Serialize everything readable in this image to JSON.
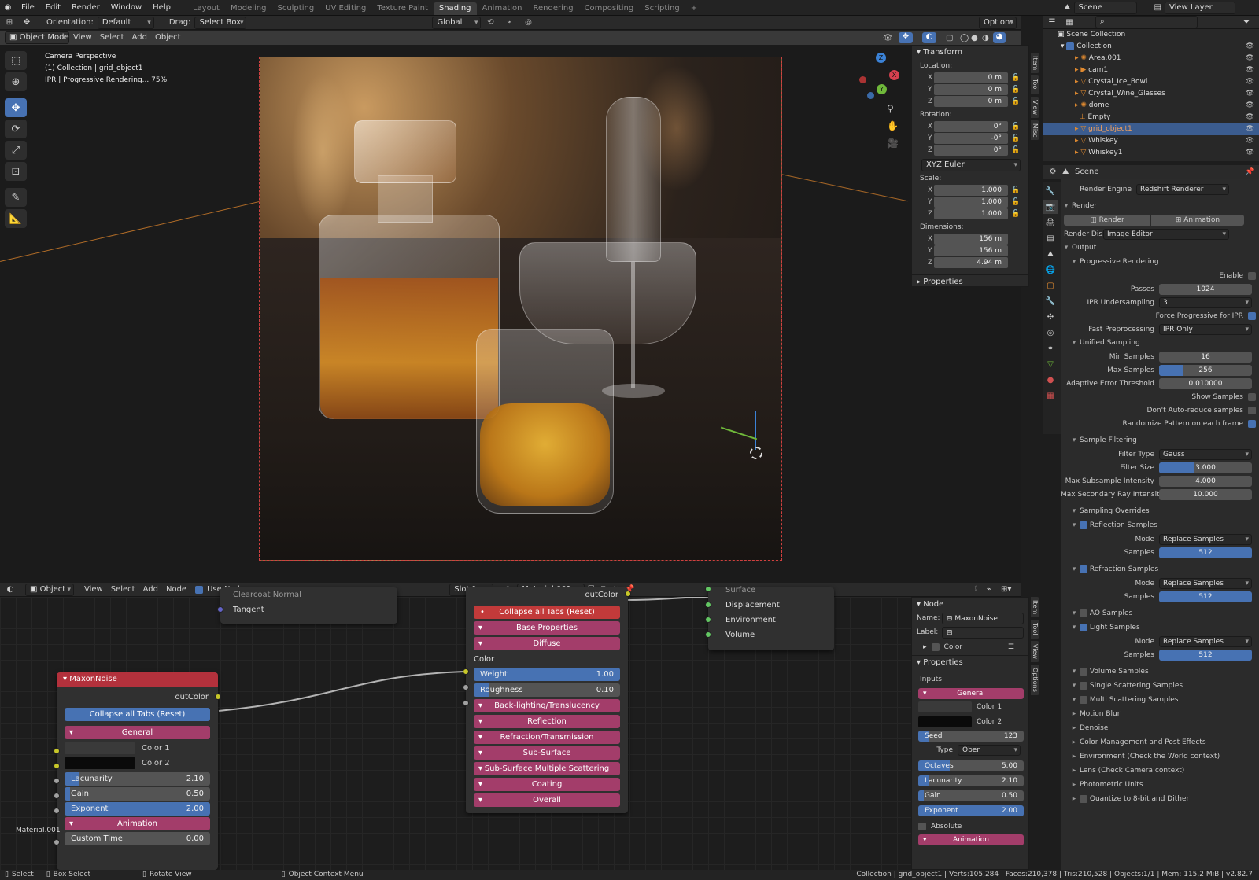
{
  "topbar": {
    "menus": [
      "File",
      "Edit",
      "Render",
      "Window",
      "Help"
    ],
    "workspaces": [
      "Layout",
      "Modeling",
      "Sculpting",
      "UV Editing",
      "Texture Paint",
      "Shading",
      "Animation",
      "Rendering",
      "Compositing",
      "Scripting"
    ],
    "active_workspace": "Shading",
    "add_tab": "+",
    "scene": "Scene",
    "view_layer": "View Layer"
  },
  "viewport_header": {
    "orientation_label": "Orientation:",
    "orientation_value": "Default",
    "drag_label": "Drag:",
    "drag_value": "Select Box",
    "transform_space": "Global",
    "options": "Options",
    "mode": "Object Mode",
    "menus": [
      "View",
      "Select",
      "Add",
      "Object"
    ]
  },
  "viewport_overlay": {
    "line1": "Camera Perspective",
    "line2": "(1) Collection | grid_object1",
    "line3": "IPR | Progressive Rendering... 75%"
  },
  "gizmo": {
    "x": "X",
    "y": "Y",
    "z": "Z"
  },
  "transform_panel": {
    "title": "Transform",
    "location_label": "Location:",
    "location": [
      {
        "axis": "X",
        "value": "0 m"
      },
      {
        "axis": "Y",
        "value": "0 m"
      },
      {
        "axis": "Z",
        "value": "0 m"
      }
    ],
    "rotation_label": "Rotation:",
    "rotation": [
      {
        "axis": "X",
        "value": "0°"
      },
      {
        "axis": "Y",
        "value": "-0°"
      },
      {
        "axis": "Z",
        "value": "0°"
      }
    ],
    "rotation_mode": "XYZ Euler",
    "scale_label": "Scale:",
    "scale": [
      {
        "axis": "X",
        "value": "1.000"
      },
      {
        "axis": "Y",
        "value": "1.000"
      },
      {
        "axis": "Z",
        "value": "1.000"
      }
    ],
    "dimensions_label": "Dimensions:",
    "dimensions": [
      {
        "axis": "X",
        "value": "156 m"
      },
      {
        "axis": "Y",
        "value": "156 m"
      },
      {
        "axis": "Z",
        "value": "4.94 m"
      }
    ],
    "properties": "Properties"
  },
  "side_tabs": [
    "Item",
    "Tool",
    "View",
    "Misc"
  ],
  "outliner": {
    "root": "Scene Collection",
    "collection": "Collection",
    "items": [
      "Area.001",
      "cam1",
      "Crystal_Ice_Bowl",
      "Crystal_Wine_Glasses",
      "dome",
      "Empty",
      "grid_object1",
      "Whiskey",
      "Whiskey1"
    ],
    "selected": "grid_object1"
  },
  "properties": {
    "scene_label": "Scene",
    "render_engine_label": "Render Engine",
    "render_engine": "Redshift Renderer",
    "render_section": "Render",
    "render_btn": "Render",
    "animation_btn": "Animation",
    "render_display_label": "Render Dis...",
    "render_display": "Image Editor",
    "output": "Output",
    "progressive": "Progressive Rendering",
    "enable": "Enable",
    "passes_label": "Passes",
    "passes": "1024",
    "ipr_under_label": "IPR Undersampling",
    "ipr_under": "3",
    "force_prog": "Force Progressive for IPR",
    "fast_pre_label": "Fast Preprocessing",
    "fast_pre": "IPR Only",
    "unified": "Unified Sampling",
    "min_samples_label": "Min Samples",
    "min_samples": "16",
    "max_samples_label": "Max Samples",
    "max_samples": "256",
    "max_samples_fraction": 0.25,
    "aet_label": "Adaptive Error Threshold",
    "aet": "0.010000",
    "show_samples": "Show Samples",
    "dont_auto": "Don't Auto-reduce samples",
    "randomize": "Randomize Pattern on each frame",
    "sample_filtering": "Sample Filtering",
    "filter_type_label": "Filter Type",
    "filter_type": "Gauss",
    "filter_size_label": "Filter Size",
    "filter_size": "3.000",
    "filter_size_fraction": 0.38,
    "max_sub_label": "Max Subsample Intensity",
    "max_sub": "4.000",
    "max_sec_label": "Max Secondary Ray Intensity",
    "max_sec": "10.000",
    "sampling_overrides": "Sampling Overrides",
    "reflection_samples": "Reflection Samples",
    "mode_label": "Mode",
    "replace_samples": "Replace Samples",
    "samples_label": "Samples",
    "samples_value": "512",
    "refraction_samples": "Refraction Samples",
    "ao_samples": "AO Samples",
    "light_samples": "Light Samples",
    "volume_samples": "Volume Samples",
    "single_scatter": "Single Scattering Samples",
    "multi_scatter": "Multi Scattering Samples",
    "motion_blur": "Motion Blur",
    "denoise": "Denoise",
    "color_mgmt": "Color Management and Post Effects",
    "environment": "Environment (Check the World context)",
    "lens": "Lens (Check Camera context)",
    "photometric": "Photometric Units",
    "quantize": "Quantize to 8-bit and Dither"
  },
  "node_header": {
    "editor_type": "Object",
    "menus": [
      "View",
      "Select",
      "Add",
      "Node"
    ],
    "use_nodes": "Use Nodes",
    "slot": "Slot 1",
    "material": "Material.001"
  },
  "node_sidebar": {
    "title": "Node",
    "name_label": "Name:",
    "name": "MaxonNoise",
    "label_label": "Label:",
    "color": "Color",
    "properties": "Properties",
    "inputs": "Inputs:",
    "general": "General",
    "color1": "Color 1",
    "color2": "Color 2",
    "seed_label": "Seed",
    "seed": "123",
    "type_label": "Type",
    "type": "Ober",
    "octaves_label": "Octaves",
    "octaves": "5.00",
    "lacunarity_label": "Lacunarity",
    "lacunarity": "2.10",
    "gain_label": "Gain",
    "gain": "0.50",
    "exponent_label": "Exponent",
    "exponent": "2.00",
    "absolute": "Absolute",
    "animation": "Animation",
    "side_tabs": [
      "Item",
      "Tool",
      "View",
      "Options"
    ]
  },
  "nodes": {
    "top_left_partial": "Clearcoat Normal",
    "tangent": "Tangent",
    "maxon_title": "MaxonNoise",
    "out_color": "outColor",
    "collapse": "Collapse all Tabs (Reset)",
    "general": "General",
    "color1": "Color 1",
    "color2": "Color 2",
    "lacunarity_label": "Lacunarity",
    "lacunarity": "2.10",
    "gain_label": "Gain",
    "gain": "0.50",
    "exponent_label": "Exponent",
    "exponent": "2.00",
    "animation": "Animation",
    "custom_time_label": "Custom Time",
    "custom_time": "0.00",
    "material_label": "Material.001",
    "mat_out_color": "outColor",
    "mat_collapse": "Collapse all Tabs (Reset)",
    "base_props": "Base Properties",
    "diffuse": "Diffuse",
    "color": "Color",
    "weight_label": "Weight",
    "weight": "1.00",
    "roughness_label": "Roughness",
    "roughness": "0.10",
    "backlighting": "Back-lighting/Translucency",
    "reflection": "Reflection",
    "refraction": "Refraction/Transmission",
    "subsurface": "Sub-Surface",
    "sss_multi": "Sub-Surface Multiple Scattering",
    "coating": "Coating",
    "overall": "Overall",
    "out_surface": "Surface",
    "out_displacement": "Displacement",
    "out_environment": "Environment",
    "out_volume": "Volume"
  },
  "status": {
    "select": "Select",
    "box_select": "Box Select",
    "rotate": "Rotate View",
    "context": "Object Context Menu",
    "stats": "Collection | grid_object1 | Verts:105,284 | Faces:210,378 | Tris:210,528 | Objects:1/1 | Mem: 115.2 MiB | v2.82.7"
  }
}
